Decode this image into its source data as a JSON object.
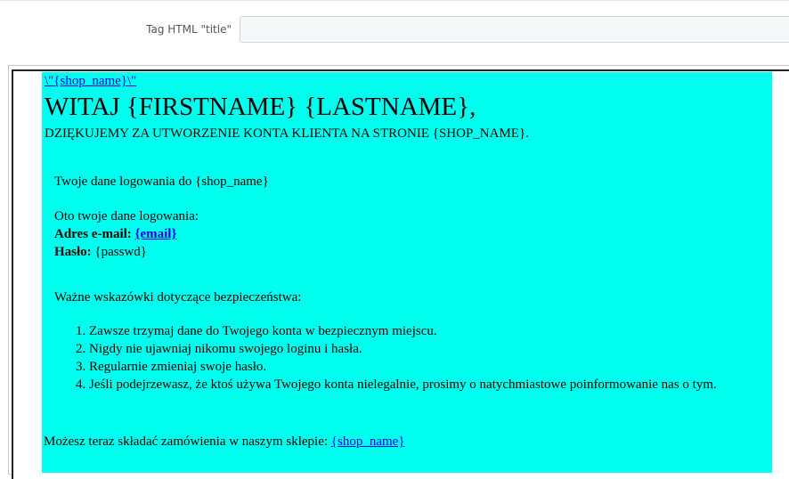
{
  "meta_title": {
    "label": "Tag HTML \"title\"",
    "value": ""
  },
  "email": {
    "shop_link": "\\\"{shop_name}\\\"",
    "greeting": "WITAJ {FIRSTNAME} {LASTNAME},",
    "thanks": "DZIĘKUJEMY ZA UTWORZENIE KONTA KLIENTA NA STRONIE {SHOP_NAME}.",
    "login_header": "Twoje dane logowania do {shop_name}",
    "login_intro": "Oto twoje dane logowania:",
    "email_label": "Adres e-mail:",
    "email_value": "{email}",
    "password_label": "Hasło:",
    "password_value": "{passwd}",
    "security_header": "Ważne wskazówki dotyczące bezpieczeństwa:",
    "security_tips": [
      "Zawsze trzymaj dane do Twojego konta w bezpiecznym miejscu.",
      "Nigdy nie ujawniaj nikomu swojego loginu i hasła.",
      "Regularnie zmieniaj swoje hasło.",
      "Jeśli podejrzewasz, że ktoś używa Twojego konta nielegalnie, prosimy o natychmiastowe poinformowanie nas o tym."
    ],
    "footer_text": "Możesz teraz składać zamówienia w naszym sklepie:",
    "footer_link": "{shop_name}"
  },
  "colors": {
    "email_background": "#00ffee",
    "link": "#0000ee"
  }
}
